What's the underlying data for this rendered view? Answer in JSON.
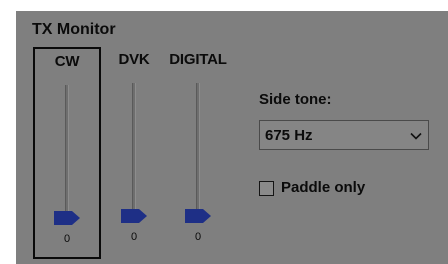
{
  "group": {
    "title": "TX Monitor"
  },
  "sliders": [
    {
      "label": "CW",
      "value": 0,
      "value_text": "0",
      "active": true
    },
    {
      "label": "DVK",
      "value": 0,
      "value_text": "0",
      "active": false
    },
    {
      "label": "DIGITAL",
      "value": 0,
      "value_text": "0",
      "active": false
    }
  ],
  "side_tone": {
    "label": "Side tone:",
    "selected": "675 Hz"
  },
  "paddle_only": {
    "label": "Paddle only",
    "checked": false
  },
  "colors": {
    "panel_bg": "#7f7f7f",
    "thumb": "#1e2f86",
    "text": "#0b0b0b"
  },
  "icons": {
    "thumb": "slider-thumb-icon",
    "dropdown": "chevron-down-icon"
  }
}
